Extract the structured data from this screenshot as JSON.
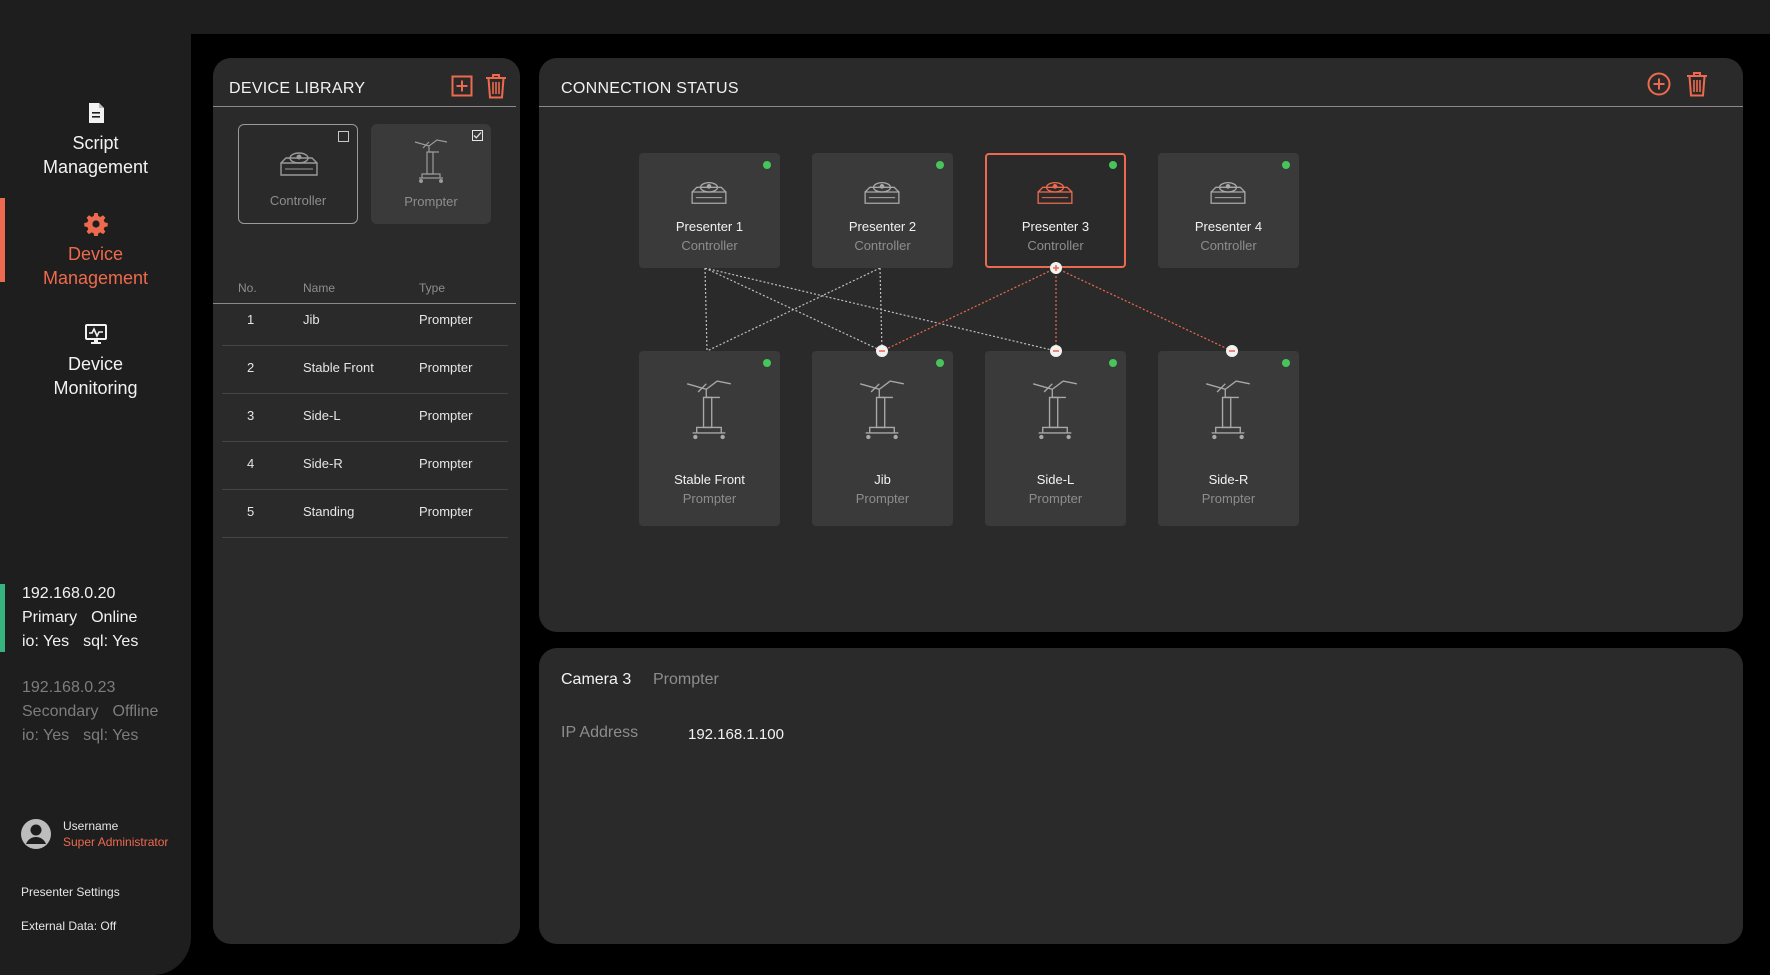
{
  "sidebar": {
    "nav": [
      {
        "label_1": "Script",
        "label_2": "Management",
        "icon": "document-icon",
        "active": false
      },
      {
        "label_1": "Device",
        "label_2": "Management",
        "icon": "gear-icon",
        "active": true
      },
      {
        "label_1": "Device",
        "label_2": "Monitoring",
        "icon": "monitor-icon",
        "active": false
      }
    ],
    "servers": [
      {
        "ip": "192.168.0.20",
        "role": "Primary",
        "state": "Online",
        "io": "io: Yes",
        "sql": "sql: Yes"
      },
      {
        "ip": "192.168.0.23",
        "role": "Secondary",
        "state": "Offline",
        "io": "io: Yes",
        "sql": "sql: Yes"
      }
    ],
    "user": {
      "name": "Username",
      "role": "Super Administrator"
    },
    "links": [
      "Presenter Settings",
      "External Data: Off"
    ]
  },
  "library": {
    "title": "DEVICE LIBRARY",
    "cards": [
      {
        "label": "Controller",
        "checked": false
      },
      {
        "label": "Prompter",
        "checked": true
      }
    ],
    "columns": [
      "No.",
      "Name",
      "Type"
    ],
    "rows": [
      {
        "no": "1",
        "name": "Jib",
        "type": "Prompter"
      },
      {
        "no": "2",
        "name": "Stable Front",
        "type": "Prompter"
      },
      {
        "no": "3",
        "name": "Side-L",
        "type": "Prompter"
      },
      {
        "no": "4",
        "name": "Side-R",
        "type": "Prompter"
      },
      {
        "no": "5",
        "name": "Standing",
        "type": "Prompter"
      }
    ]
  },
  "connection": {
    "title": "CONNECTION STATUS",
    "controllers": [
      {
        "name": "Presenter 1",
        "type": "Controller",
        "online": true,
        "selected": false
      },
      {
        "name": "Presenter 2",
        "type": "Controller",
        "online": true,
        "selected": false
      },
      {
        "name": "Presenter 3",
        "type": "Controller",
        "online": true,
        "selected": true
      },
      {
        "name": "Presenter 4",
        "type": "Controller",
        "online": true,
        "selected": false
      }
    ],
    "prompters": [
      {
        "name": "Stable Front",
        "type": "Prompter",
        "online": true
      },
      {
        "name": "Jib",
        "type": "Prompter",
        "online": true
      },
      {
        "name": "Side-L",
        "type": "Prompter",
        "online": true
      },
      {
        "name": "Side-R",
        "type": "Prompter",
        "online": true
      }
    ],
    "links": [
      {
        "from": "Presenter 1",
        "to": "Stable Front",
        "highlight": false
      },
      {
        "from": "Presenter 1",
        "to": "Jib",
        "highlight": false
      },
      {
        "from": "Presenter 1",
        "to": "Side-L",
        "highlight": false
      },
      {
        "from": "Presenter 2",
        "to": "Stable Front",
        "highlight": false
      },
      {
        "from": "Presenter 2",
        "to": "Jib",
        "highlight": false
      },
      {
        "from": "Presenter 3",
        "to": "Jib",
        "highlight": true
      },
      {
        "from": "Presenter 3",
        "to": "Side-L",
        "highlight": true
      },
      {
        "from": "Presenter 3",
        "to": "Side-R",
        "highlight": true
      }
    ],
    "colors": {
      "accent": "#ee6a4e",
      "online": "#46c65a",
      "link": "#bfbfbf"
    }
  },
  "details": {
    "name": "Camera 3",
    "type": "Prompter",
    "ip_label": "IP Address",
    "ip_value": "192.168.1.100"
  }
}
